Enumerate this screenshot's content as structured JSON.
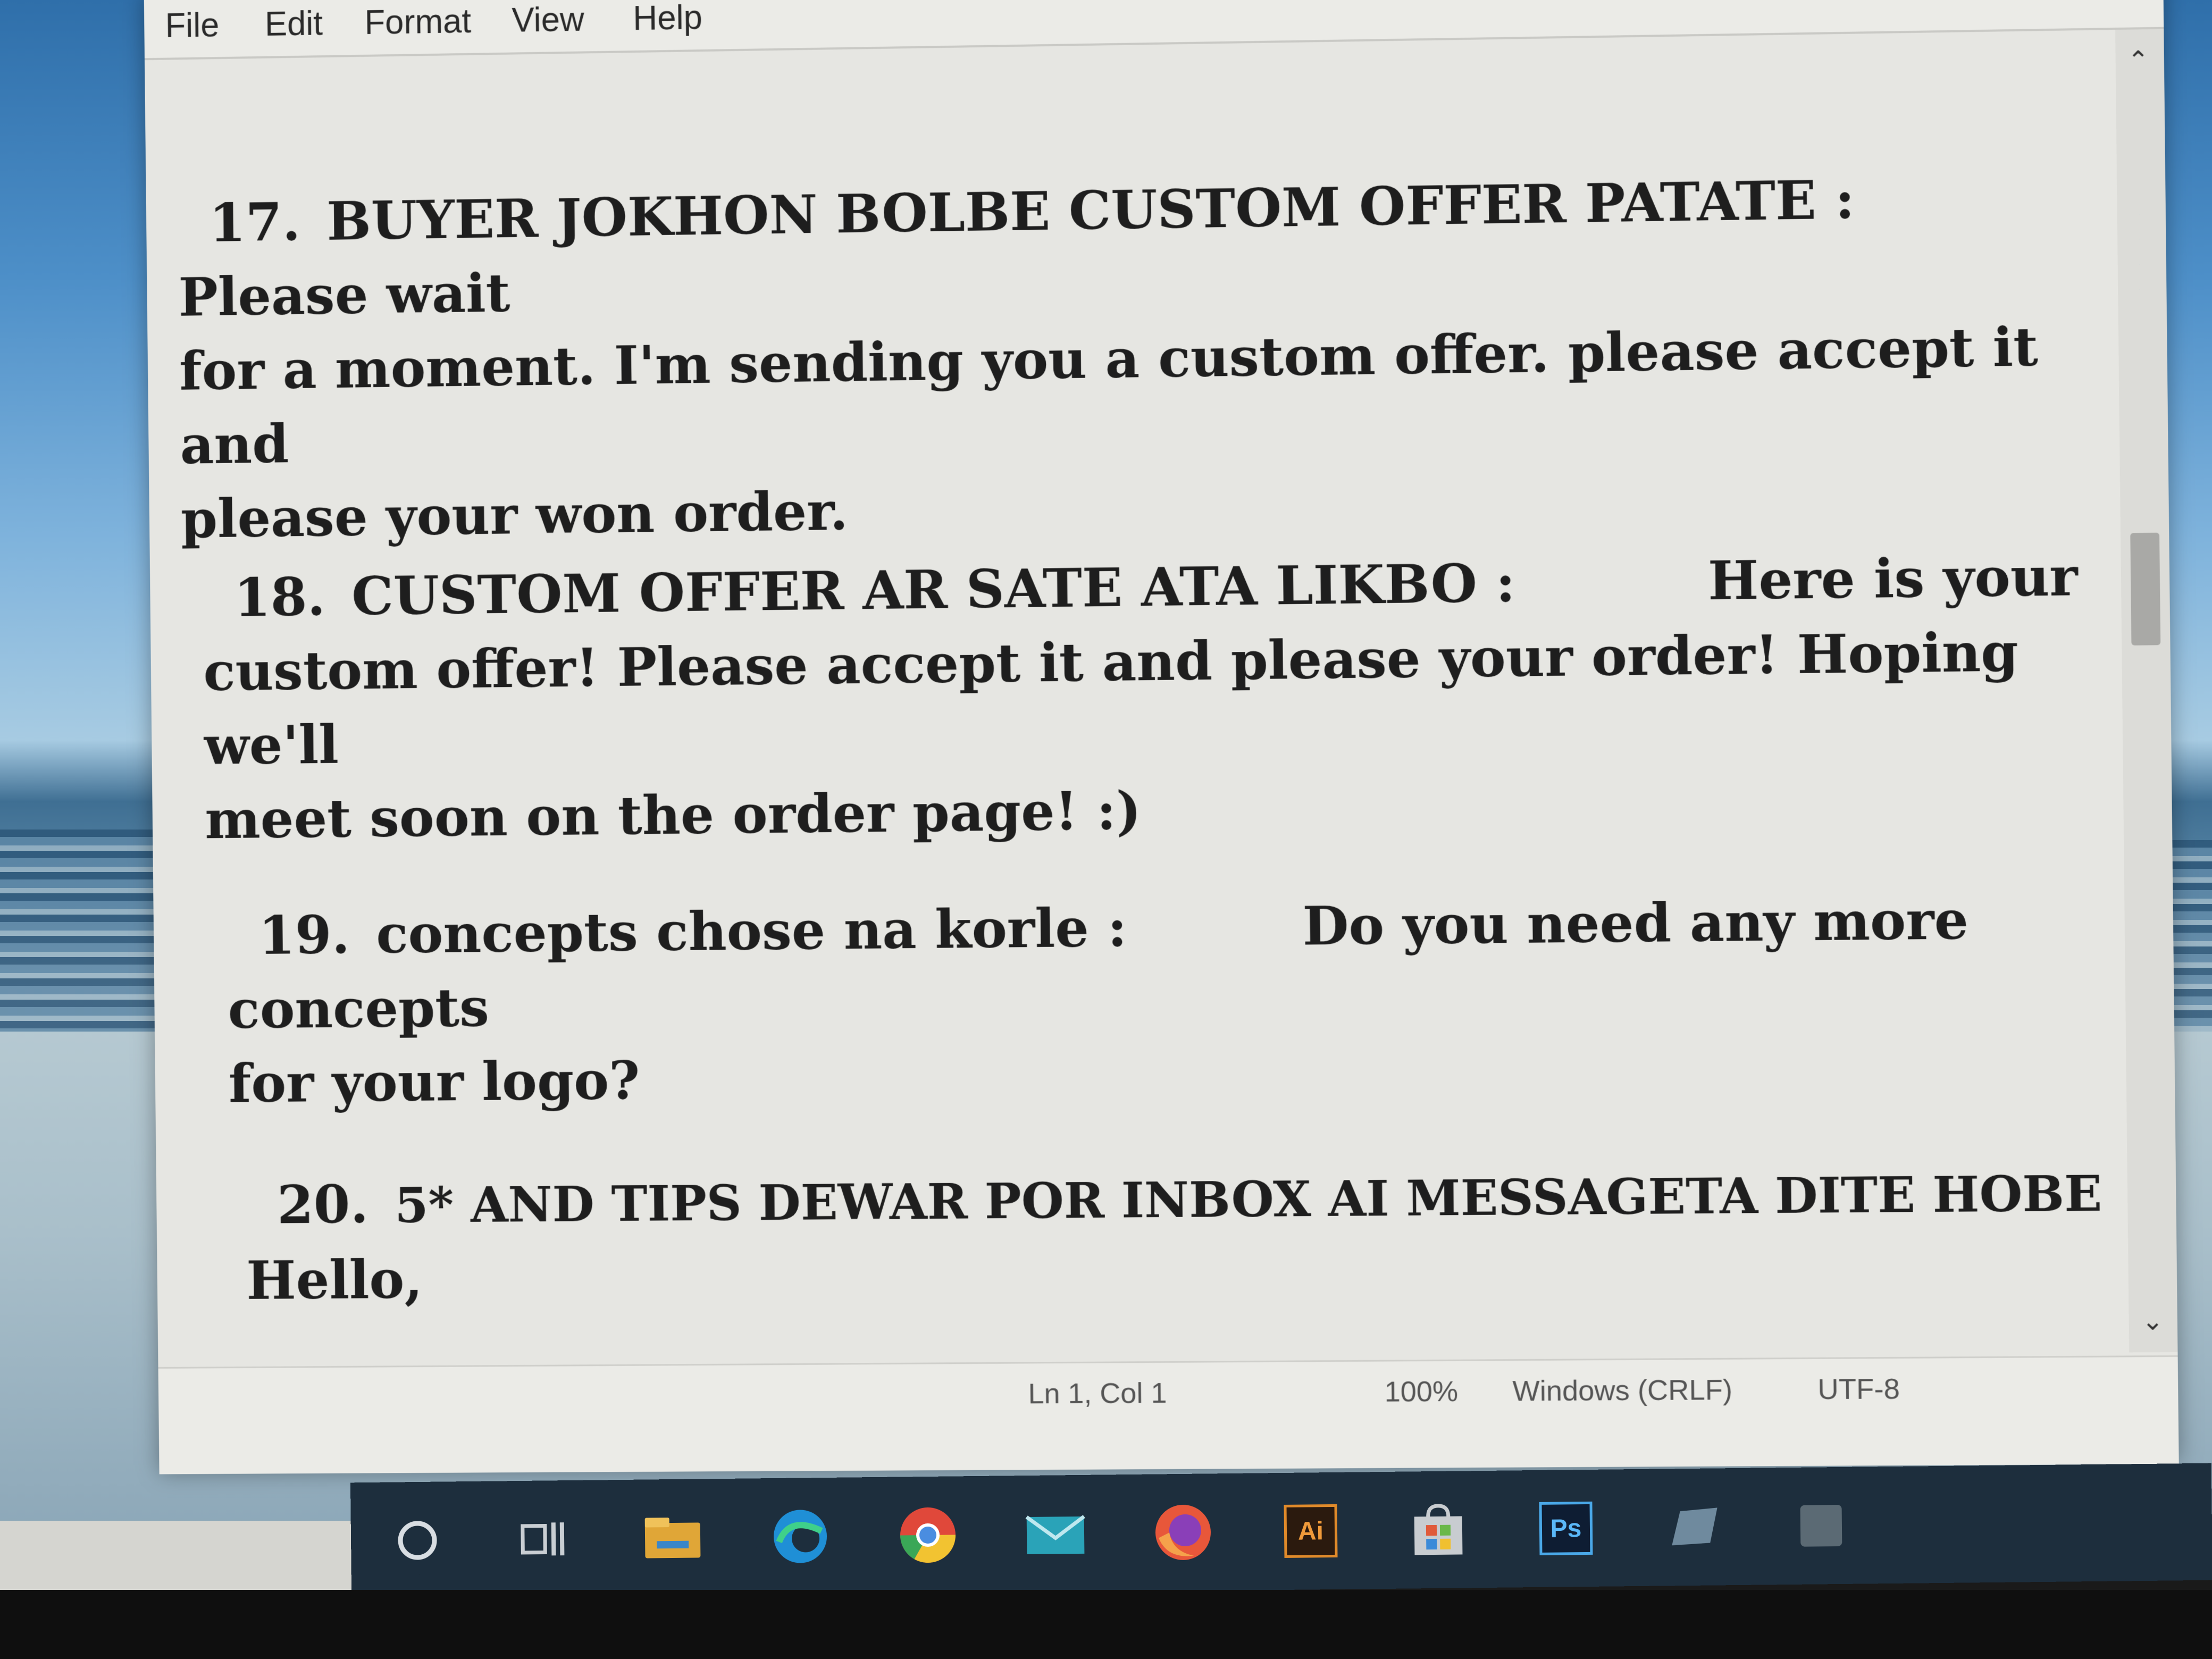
{
  "menu": {
    "file": "File",
    "edit": "Edit",
    "format": "Format",
    "view": "View",
    "help": "Help"
  },
  "entries": [
    {
      "number": "17.",
      "heading": "BUYER JOKHON BOLBE CUSTOM OFFER PATATE :",
      "line1_tail": "Please wait",
      "line2": "for a moment. I'm sending you a custom offer. please accept it and",
      "line3": "please your won order."
    },
    {
      "number": "18.",
      "heading": "CUSTOM OFFER AR SATE ATA LIKBO :",
      "line1_tail": "Here is your",
      "line2": "custom offer! Please accept it and please your order! Hoping we'll",
      "line3": "meet soon on the order page! :)"
    },
    {
      "number": "19.",
      "heading": "concepts chose na korle :",
      "line1_tail": "Do you need any more concepts",
      "line2": "for your logo?"
    },
    {
      "number": "20.",
      "heading": "5* AND TIPS DEWAR POR INBOX  AI MESSAGETA DITE HOBE :",
      "line2": "Hello,"
    }
  ],
  "status": {
    "position": "Ln 1, Col 1",
    "zoom": "100%",
    "line_ending": "Windows (CRLF)",
    "encoding": "UTF-8"
  },
  "taskbar": {
    "illustrator_label": "Ai",
    "photoshop_label": "Ps"
  },
  "colors": {
    "editor_bg": "#e6e6e2",
    "text": "#1e1e1e",
    "taskbar": "#1d2e3d"
  }
}
